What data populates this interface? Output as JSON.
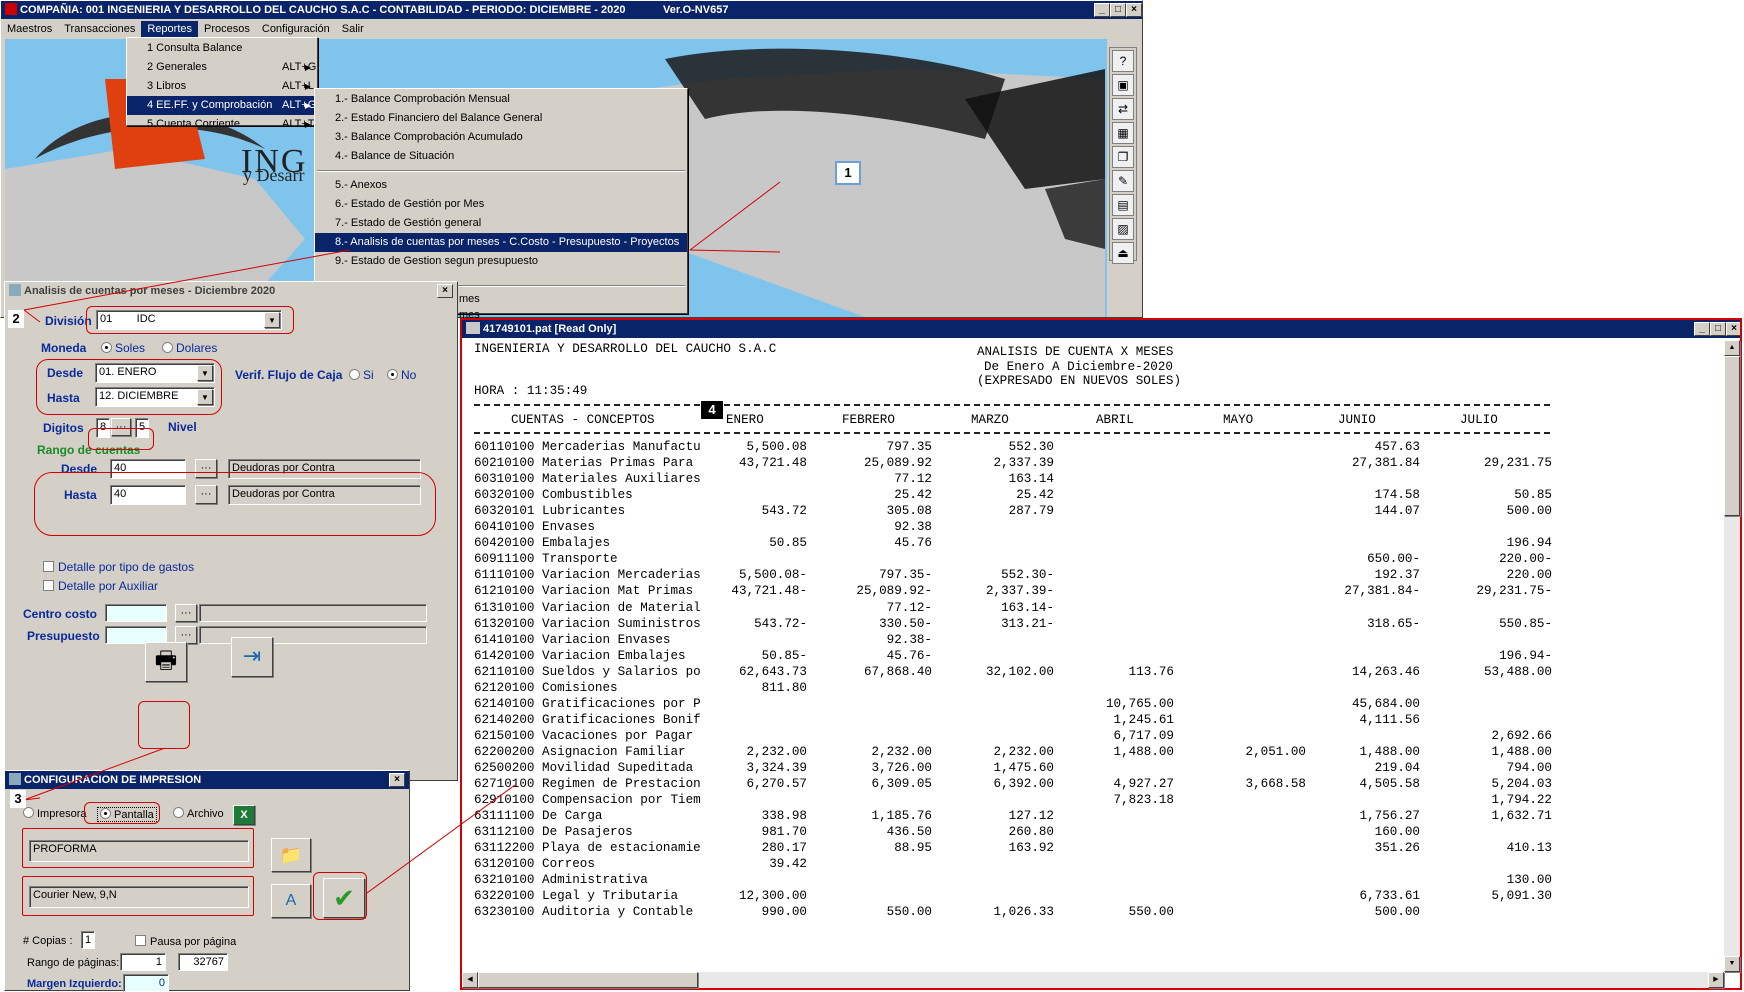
{
  "main_window": {
    "title": "COMPAÑIA: 001 INGENIERIA Y DESARROLLO DEL CAUCHO S.A.C   -   CONTABILIDAD   -   PERIODO: DICIEMBRE - 2020",
    "version": "Ver.O-NV657"
  },
  "menubar": [
    "Maestros",
    "Transacciones",
    "Reportes",
    "Procesos",
    "Configuración",
    "Salir"
  ],
  "reportes_menu": [
    {
      "label": "1 Consulta Balance",
      "accel": "",
      "arrow": false
    },
    {
      "label": "2 Generales",
      "accel": "ALT+G",
      "arrow": true
    },
    {
      "label": "3 Libros",
      "accel": "ALT+L",
      "arrow": true
    },
    {
      "label": "4 EE.FF. y Comprobación",
      "accel": "ALT+G",
      "arrow": true
    },
    {
      "label": "5 Cuenta Corriente",
      "accel": "ALT+T",
      "arrow": true
    }
  ],
  "eeff_submenu": [
    "1.- Balance Comprobación Mensual",
    "2.- Estado Financiero del Balance General",
    "3.- Balance Comprobación Acumulado",
    "4.- Balance de Situación",
    "5.- Anexos",
    "6.- Estado de Gestión por Mes",
    "7.- Estado de Gestión general",
    "8.- Analisis de cuentas por meses  - C.Costo - Presupuesto - Proyectos",
    "9.- Estado de Gestion segun presupuesto",
    "mes",
    "mes"
  ],
  "background": {
    "brand_text": "ING",
    "brand_sub": "y Desarr"
  },
  "analysis_dialog": {
    "title": "Analisis de cuentas por meses - Diciembre 2020",
    "division_label": "División",
    "division_value": "01        IDC",
    "moneda_label": "Moneda",
    "moneda_soles": "Soles",
    "moneda_dolares": "Dolares",
    "desde_label": "Desde",
    "desde_value": "01. ENERO",
    "hasta_label": "Hasta",
    "hasta_value": "12. DICIEMBRE",
    "verif_label": "Verif. Flujo de Caja",
    "si": "Si",
    "no": "No",
    "digitos_label": "Digitos",
    "digitos_value": "8",
    "digitos_btn": "···",
    "nivel_value": "5",
    "nivel_label": "Nivel",
    "rango_label": "Rango de cuentas",
    "rango_desde_label": "Desde",
    "rango_desde_value": "40",
    "rango_desde_desc": "Deudoras por Contra",
    "rango_hasta_label": "Hasta",
    "rango_hasta_value": "40",
    "rango_hasta_desc": "Deudoras por Contra",
    "detalle_gastos": "Detalle por tipo de gastos",
    "detalle_auxiliar": "Detalle por Auxiliar",
    "centro_costo_label": "Centro costo",
    "presupuesto_label": "Presupuesto",
    "dots": "···"
  },
  "print_dialog": {
    "title": "CONFIGURACION DE IMPRESION",
    "impresora": "Impresora",
    "pantalla": "Pantalla",
    "archivo": "Archivo",
    "format_value": "PROFORMA",
    "font_value": "Courier New, 9,N",
    "copias_label": "# Copias :",
    "copias_value": "1",
    "pausa_label": "Pausa por página",
    "rango_label": "Rango de páginas:",
    "rango_from": "1",
    "rango_to": "32767",
    "margen_label": "Margen Izquierdo:",
    "margen_value": "0"
  },
  "callouts": [
    "1",
    "2",
    "3",
    "4"
  ],
  "report_window": {
    "title": "41749101.pat [Read Only]",
    "company": "INGENIERIA Y DESARROLLO DEL CAUCHO S.A.C",
    "title1": "ANALISIS DE CUENTA X MESES",
    "title2": "De Enero A Diciembre-2020",
    "title3": "(EXPRESADO EN NUEVOS SOLES)",
    "hora": "HORA : 11:35:49",
    "headers": [
      "CUENTAS - CONCEPTOS",
      "ENERO",
      "FEBRERO",
      "MARZO",
      "ABRIL",
      "MAYO",
      "JUNIO",
      "JULIO"
    ],
    "rows": [
      [
        "60110100 Mercaderias Manufactu",
        "5,500.08",
        "797.35",
        "552.30",
        "",
        "",
        "457.63",
        ""
      ],
      [
        "60210100 Materias Primas Para",
        "43,721.48",
        "25,089.92",
        "2,337.39",
        "",
        "",
        "27,381.84",
        "29,231.75"
      ],
      [
        "60310100 Materiales Auxiliares",
        "",
        "77.12",
        "163.14",
        "",
        "",
        "",
        ""
      ],
      [
        "60320100 Combustibles",
        "",
        "25.42",
        "25.42",
        "",
        "",
        "174.58",
        "50.85"
      ],
      [
        "60320101 Lubricantes",
        "543.72",
        "305.08",
        "287.79",
        "",
        "",
        "144.07",
        "500.00"
      ],
      [
        "60410100 Envases",
        "",
        "92.38",
        "",
        "",
        "",
        "",
        ""
      ],
      [
        "60420100 Embalajes",
        "50.85",
        "45.76",
        "",
        "",
        "",
        "",
        "196.94"
      ],
      [
        "60911100 Transporte",
        "",
        "",
        "",
        "",
        "",
        "650.00-",
        "220.00-"
      ],
      [
        "61110100 Variacion Mercaderias",
        "5,500.08-",
        "797.35-",
        "552.30-",
        "",
        "",
        "192.37",
        "220.00"
      ],
      [
        "61210100 Variacion Mat Primas",
        "43,721.48-",
        "25,089.92-",
        "2,337.39-",
        "",
        "",
        "27,381.84-",
        "29,231.75-"
      ],
      [
        "61310100 Variacion de Material",
        "",
        "77.12-",
        "163.14-",
        "",
        "",
        "",
        ""
      ],
      [
        "61320100 Variacion Suministros",
        "543.72-",
        "330.50-",
        "313.21-",
        "",
        "",
        "318.65-",
        "550.85-"
      ],
      [
        "61410100 Variacion Envases",
        "",
        "92.38-",
        "",
        "",
        "",
        "",
        ""
      ],
      [
        "61420100 Variacion Embalajes",
        "50.85-",
        "45.76-",
        "",
        "",
        "",
        "",
        "196.94-"
      ],
      [
        "62110100 Sueldos y Salarios po",
        "62,643.73",
        "67,868.40",
        "32,102.00",
        "113.76",
        "",
        "14,263.46",
        "53,488.00"
      ],
      [
        "62120100 Comisiones",
        "811.80",
        "",
        "",
        "",
        "",
        "",
        ""
      ],
      [
        "62140100 Gratificaciones por P",
        "",
        "",
        "",
        "10,765.00",
        "",
        "45,684.00",
        ""
      ],
      [
        "62140200 Gratificaciones Bonif",
        "",
        "",
        "",
        "1,245.61",
        "",
        "4,111.56",
        ""
      ],
      [
        "62150100 Vacaciones por Pagar",
        "",
        "",
        "",
        "6,717.09",
        "",
        "",
        "2,692.66"
      ],
      [
        "62200200 Asignacion Familiar",
        "2,232.00",
        "2,232.00",
        "2,232.00",
        "1,488.00",
        "2,051.00",
        "1,488.00",
        "1,488.00"
      ],
      [
        "62500200 Movilidad Supeditada",
        "3,324.39",
        "3,726.00",
        "1,475.60",
        "",
        "",
        "219.04",
        "794.00"
      ],
      [
        "62710100 Regimen de Prestacion",
        "6,270.57",
        "6,309.05",
        "6,392.00",
        "4,927.27",
        "3,668.58",
        "4,505.58",
        "5,204.03"
      ],
      [
        "62910100 Compensacion por Tiem",
        "",
        "",
        "",
        "7,823.18",
        "",
        "",
        "1,794.22"
      ],
      [
        "63111100 De Carga",
        "338.98",
        "1,185.76",
        "127.12",
        "",
        "",
        "1,756.27",
        "1,632.71"
      ],
      [
        "63112100 De Pasajeros",
        "981.70",
        "436.50",
        "260.80",
        "",
        "",
        "160.00",
        ""
      ],
      [
        "63112200 Playa de estacionamie",
        "280.17",
        "88.95",
        "163.92",
        "",
        "",
        "351.26",
        "410.13"
      ],
      [
        "63120100 Correos",
        "39.42",
        "",
        "",
        "",
        "",
        "",
        ""
      ],
      [
        "63210100 Administrativa",
        "",
        "",
        "",
        "",
        "",
        "",
        "130.00"
      ],
      [
        "63220100 Legal y Tributaria",
        "12,300.00",
        "",
        "",
        "",
        "",
        "6,733.61",
        "5,091.30"
      ],
      [
        "63230100 Auditoria y Contable",
        "990.00",
        "550.00",
        "1,026.33",
        "550.00",
        "",
        "500.00",
        ""
      ]
    ]
  },
  "colors": {
    "titlebar": "#0a246a",
    "window": "#d4d0c8",
    "annotation": "#d40000",
    "label_blue": "#0a2a9a",
    "label_green": "#1a8a2a",
    "map_water": "#7ec4ec",
    "map_land": "#c8c8c8"
  }
}
